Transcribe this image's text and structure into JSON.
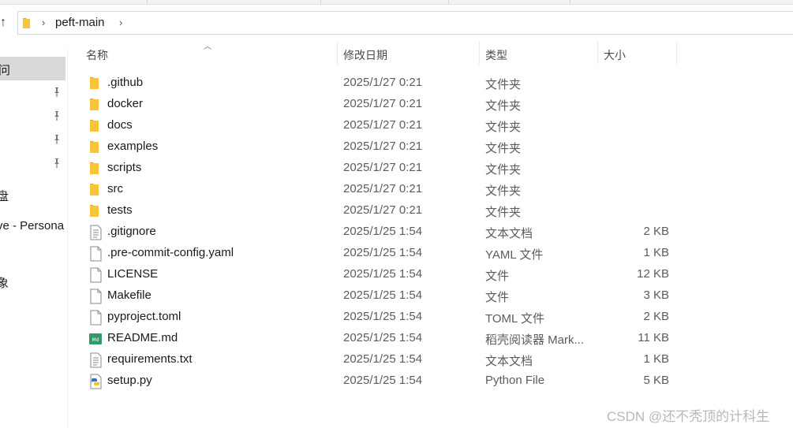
{
  "address_bar": {
    "path_segment": "peft-main"
  },
  "navigation": {
    "selected_item": "问",
    "items": [
      {
        "label": "盘"
      },
      {
        "label": "ve - Persona"
      },
      {
        "label": "象"
      }
    ]
  },
  "columns": {
    "name": "名称",
    "date_modified": "修改日期",
    "type": "类型",
    "size": "大小"
  },
  "files": [
    {
      "icon": "folder-icon",
      "name": ".github",
      "date": "2025/1/27 0:21",
      "type": "文件夹",
      "size": ""
    },
    {
      "icon": "folder-icon",
      "name": "docker",
      "date": "2025/1/27 0:21",
      "type": "文件夹",
      "size": ""
    },
    {
      "icon": "folder-icon",
      "name": "docs",
      "date": "2025/1/27 0:21",
      "type": "文件夹",
      "size": ""
    },
    {
      "icon": "folder-icon",
      "name": "examples",
      "date": "2025/1/27 0:21",
      "type": "文件夹",
      "size": ""
    },
    {
      "icon": "folder-icon",
      "name": "scripts",
      "date": "2025/1/27 0:21",
      "type": "文件夹",
      "size": ""
    },
    {
      "icon": "folder-icon",
      "name": "src",
      "date": "2025/1/27 0:21",
      "type": "文件夹",
      "size": ""
    },
    {
      "icon": "folder-icon",
      "name": "tests",
      "date": "2025/1/27 0:21",
      "type": "文件夹",
      "size": ""
    },
    {
      "icon": "text-file-icon",
      "name": ".gitignore",
      "date": "2025/1/25 1:54",
      "type": "文本文档",
      "size": "2 KB"
    },
    {
      "icon": "file-icon",
      "name": ".pre-commit-config.yaml",
      "date": "2025/1/25 1:54",
      "type": "YAML 文件",
      "size": "1 KB"
    },
    {
      "icon": "file-icon",
      "name": "LICENSE",
      "date": "2025/1/25 1:54",
      "type": "文件",
      "size": "12 KB"
    },
    {
      "icon": "file-icon",
      "name": "Makefile",
      "date": "2025/1/25 1:54",
      "type": "文件",
      "size": "3 KB"
    },
    {
      "icon": "file-icon",
      "name": "pyproject.toml",
      "date": "2025/1/25 1:54",
      "type": "TOML 文件",
      "size": "2 KB"
    },
    {
      "icon": "markdown-icon",
      "name": "README.md",
      "date": "2025/1/25 1:54",
      "type": "稻壳阅读器 Mark...",
      "size": "11 KB"
    },
    {
      "icon": "text-file-icon",
      "name": "requirements.txt",
      "date": "2025/1/25 1:54",
      "type": "文本文档",
      "size": "1 KB"
    },
    {
      "icon": "python-file-icon",
      "name": "setup.py",
      "date": "2025/1/25 1:54",
      "type": "Python File",
      "size": "5 KB"
    }
  ],
  "watermark": "CSDN @还不秃顶的计科生",
  "colors": {
    "folder": "#f8c43a",
    "selection": "#d9d9d9",
    "markdown_badge": "#2e9b6f"
  }
}
